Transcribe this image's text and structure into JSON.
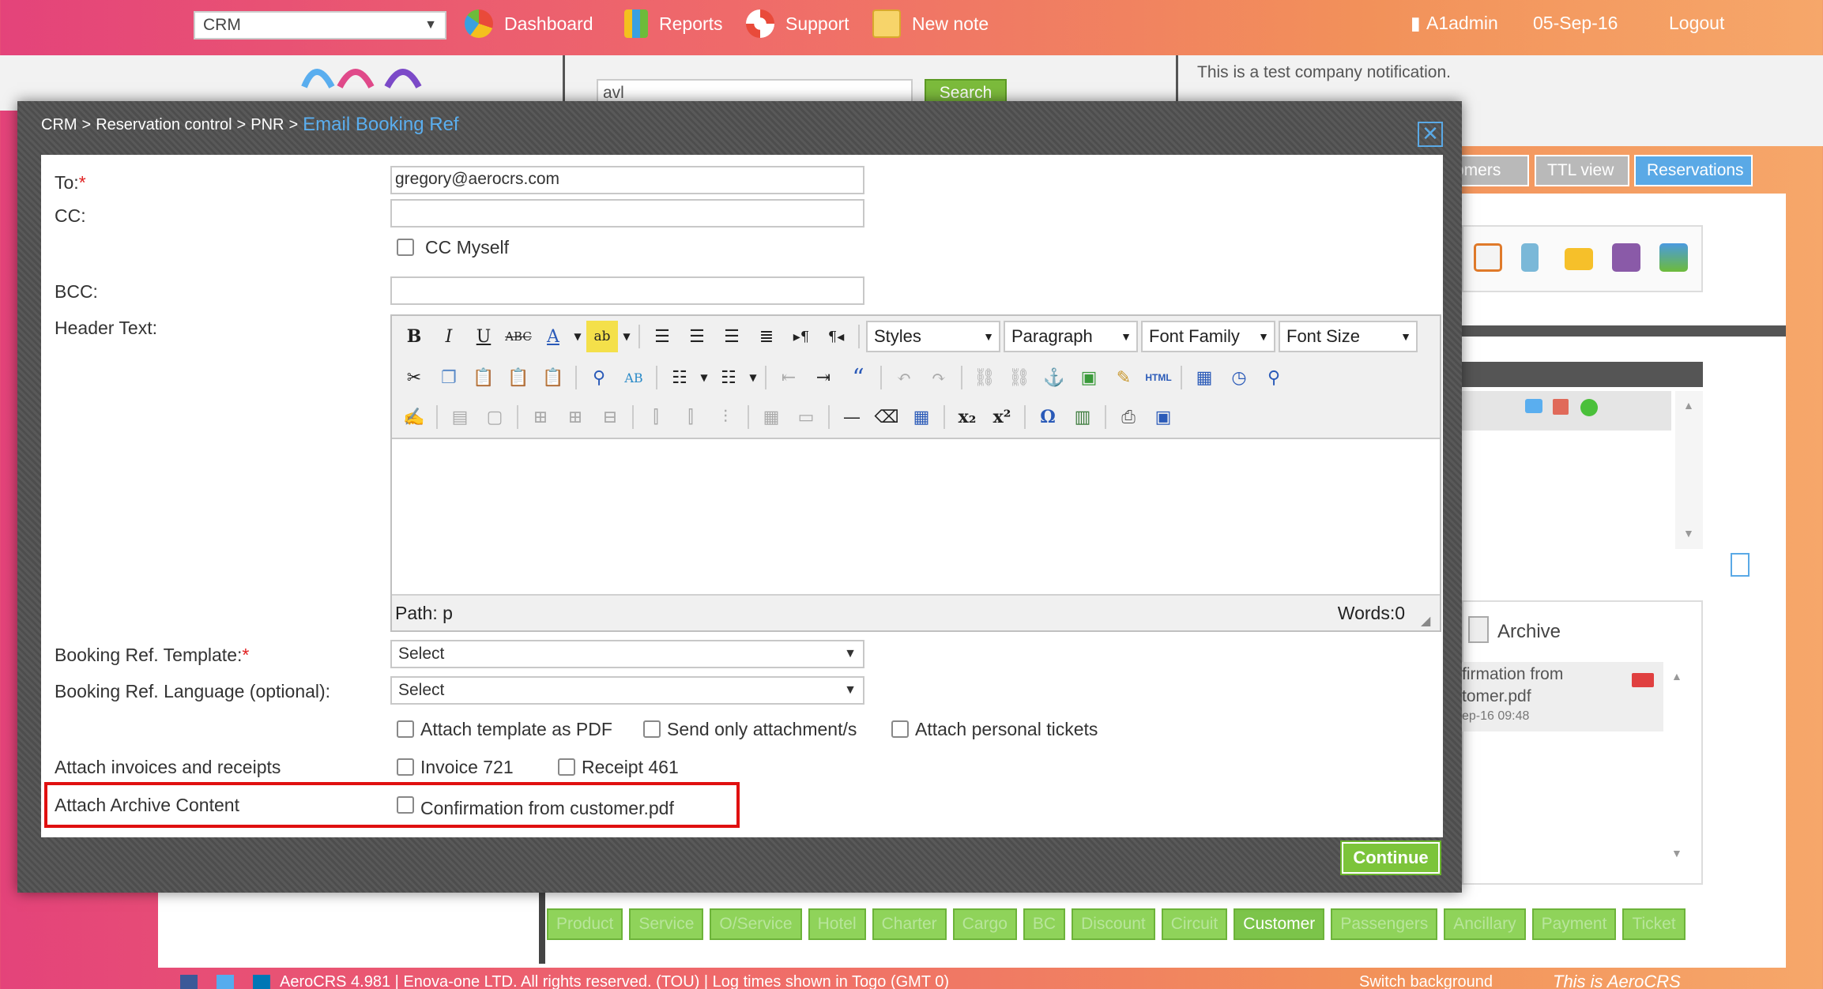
{
  "topbar": {
    "module_select": "CRM",
    "nav": [
      {
        "label": "Dashboard",
        "icon": "pie-chart-icon"
      },
      {
        "label": "Reports",
        "icon": "bar-chart-icon"
      },
      {
        "label": "Support",
        "icon": "lifebuoy-icon"
      },
      {
        "label": "New note",
        "icon": "note-icon"
      }
    ],
    "user": "A1admin",
    "date": "05-Sep-16",
    "logout": "Logout"
  },
  "background": {
    "search_value": "avl",
    "search_button": "Search",
    "notification": "This is a test company notification.",
    "tabs": [
      "omers",
      "TTL view",
      "Reservations"
    ],
    "archive_title": "Archive",
    "archive_item_name": "firmation from\ntomer.pdf",
    "archive_item_date": "ep-16 09:48",
    "bottom_tabs": [
      "Product",
      "Service",
      "O/Service",
      "Hotel",
      "Charter",
      "Cargo",
      "BC",
      "Discount",
      "Circuit",
      "Customer",
      "Passengers",
      "Ancillary",
      "Payment",
      "Ticket"
    ],
    "active_bottom_tab": "Customer",
    "footer": "AeroCRS 4.981 | Enova-one LTD. All rights reserved. (TOU) | Log times shown in Togo (GMT 0)",
    "switch_background": "Switch background",
    "brand": "This is AeroCRS"
  },
  "modal": {
    "breadcrumb": [
      "CRM",
      "Reservation control",
      "PNR"
    ],
    "breadcrumb_sep": ">",
    "title": "Email Booking Ref",
    "close_icon": "close-icon",
    "form": {
      "to_label": "To:",
      "to_value": "gregory@aerocrs.com",
      "cc_label": "CC:",
      "cc_value": "",
      "cc_myself": "CC Myself",
      "bcc_label": "BCC:",
      "bcc_value": "",
      "header_text_label": "Header Text:",
      "editor": {
        "styles": "Styles",
        "paragraph": "Paragraph",
        "font_family": "Font Family",
        "font_size": "Font Size",
        "path": "Path: p",
        "words": "Words:0"
      },
      "template_label": "Booking Ref. Template:",
      "template_value": "Select",
      "language_label": "Booking Ref. Language (optional):",
      "language_value": "Select",
      "attach_pdf": "Attach template as PDF",
      "send_only_attachments": "Send only attachment/s",
      "attach_personal_tickets": "Attach personal tickets",
      "invoices_label": "Attach invoices and receipts",
      "invoice": "Invoice 721",
      "receipt": "Receipt 461",
      "archive_label": "Attach Archive Content",
      "archive_file": "Confirmation from customer.pdf"
    },
    "continue": "Continue"
  },
  "colors": {
    "accent_blue": "#5aaeef",
    "continue_green": "#7cc43a",
    "highlight_red": "#e01010"
  }
}
